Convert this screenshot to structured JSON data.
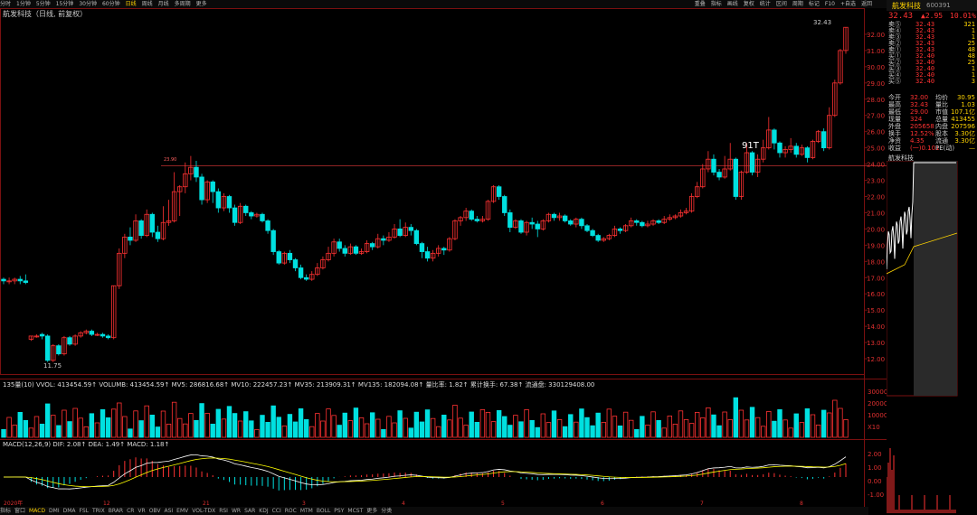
{
  "colors": {
    "up": "#ff3232",
    "down": "#00e0e0",
    "bg": "#000000",
    "grid": "#7a1010",
    "ma5": "#ffffff",
    "ma10": "#ffff00",
    "ma20": "#ff00ff",
    "vol_up": "#ff3232",
    "vol_down": "#00e0e0",
    "accent": "#ffd400"
  },
  "toolbar": {
    "left_tabs": [
      "分时",
      "1分钟",
      "5分钟",
      "15分钟",
      "30分钟",
      "60分钟",
      "日线",
      "周线",
      "月线",
      "多周期",
      "更多"
    ],
    "right_tabs": [
      "重叠",
      "指标",
      "画线",
      "复权",
      "统计",
      "区间",
      "周期",
      "标记",
      "F10",
      "+自选",
      "返回"
    ]
  },
  "chart_title": "航发科技（日线, 前复权）",
  "annotations": {
    "low_label": "11.75",
    "high_label": "32.43",
    "t_label": "91T",
    "hline_value": "23.90"
  },
  "vol_line": "135量(10) VVOL: 413454.59↑ VOLUMB: 413454.59↑ MV5: 286816.68↑ MV10: 222457.23↑ MV35: 213909.31↑ MV135: 182094.08↑ 量比率: 1.82↑ 累计换手: 67.38↑ 流通盘: 330129408.00",
  "macd_line": "MACD(12,26,9) DIF: 2.08↑ DEA: 1.49↑ MACD: 1.18↑",
  "y_axis": [
    "32.00",
    "31.00",
    "30.00",
    "29.00",
    "28.00",
    "27.00",
    "26.00",
    "25.00",
    "24.00",
    "23.00",
    "22.00",
    "21.00",
    "20.00",
    "19.00",
    "18.00",
    "17.00",
    "16.00",
    "15.00",
    "14.00",
    "13.00",
    "12.00"
  ],
  "vol_axis": [
    "30000",
    "20000",
    "10000",
    "X10"
  ],
  "macd_axis": [
    "2.00",
    "1.00",
    "0.00",
    "-1.00"
  ],
  "bottom_tabs": [
    "指标",
    "窗口",
    "MACD",
    "DMI",
    "DMA",
    "FSL",
    "TRIX",
    "BRAR",
    "CR",
    "VR",
    "OBV",
    "ASI",
    "EMV",
    "VOL-TDX",
    "RSI",
    "WR",
    "SAR",
    "KDJ",
    "CCI",
    "ROC",
    "MTM",
    "BOLL",
    "PSY",
    "MCST",
    "更多",
    "分类"
  ],
  "date_labels": [
    "2020年",
    "12",
    "21",
    "3",
    "4",
    "5",
    "6",
    "7",
    "8"
  ],
  "chart_data": {
    "type": "candlestick",
    "ylim": [
      11,
      33
    ],
    "candles": [
      [
        16.9,
        16.8,
        17,
        16.6
      ],
      [
        16.8,
        16.8,
        17,
        16.6
      ],
      [
        16.8,
        16.9,
        17,
        16.6
      ],
      [
        16.9,
        16.8,
        17.1,
        16.6
      ],
      [
        16.8,
        16.7,
        17.2,
        16.6
      ],
      [
        13.2,
        13.4,
        13.4,
        13.1
      ],
      [
        13.4,
        13.4,
        13.5,
        13.3
      ],
      [
        13.5,
        13.4,
        13.6,
        13.2
      ],
      [
        13.4,
        11.9,
        13.5,
        11.8
      ],
      [
        11.9,
        12.8,
        12.9,
        11.8
      ],
      [
        12.8,
        12.3,
        12.9,
        12.2
      ],
      [
        12.3,
        13.3,
        13.4,
        12.2
      ],
      [
        13.3,
        12.9,
        13.4,
        12.8
      ],
      [
        12.9,
        13.4,
        13.5,
        12.8
      ],
      [
        13.4,
        13.6,
        13.7,
        13.3
      ],
      [
        13.6,
        13.7,
        13.8,
        13.5
      ],
      [
        13.7,
        13.5,
        13.8,
        13.4
      ],
      [
        13.5,
        13.5,
        13.6,
        13.4
      ],
      [
        13.5,
        13.4,
        13.6,
        13.3
      ],
      [
        13.4,
        13.3,
        13.5,
        13.2
      ],
      [
        13.3,
        16.5,
        16.5,
        13.2
      ],
      [
        16.5,
        18.5,
        18.8,
        16.3
      ],
      [
        18.5,
        19.5,
        19.7,
        18.2
      ],
      [
        19.5,
        19.3,
        20.1,
        19.0
      ],
      [
        19.3,
        20.5,
        20.9,
        19.2
      ],
      [
        20.5,
        19.6,
        20.6,
        19.4
      ],
      [
        19.6,
        20.9,
        21.2,
        19.5
      ],
      [
        20.9,
        19.8,
        21.0,
        19.5
      ],
      [
        19.8,
        19.4,
        20.2,
        19.2
      ],
      [
        19.4,
        20.4,
        21.4,
        19.3
      ],
      [
        20.4,
        20.5,
        21.8,
        20.2
      ],
      [
        20.5,
        22.3,
        23.5,
        20.4
      ],
      [
        22.3,
        22.6,
        22.7,
        20.8
      ],
      [
        22.6,
        23.4,
        24.1,
        22.2
      ],
      [
        23.4,
        23.8,
        24.5,
        23.0
      ],
      [
        23.8,
        23.2,
        24.2,
        22.9
      ],
      [
        23.2,
        21.8,
        23.4,
        21.5
      ],
      [
        21.8,
        22.9,
        23.0,
        21.6
      ],
      [
        22.9,
        22.3,
        23.0,
        21.6
      ],
      [
        22.3,
        21.3,
        22.5,
        21.0
      ],
      [
        21.3,
        22.0,
        22.2,
        21.1
      ],
      [
        22.0,
        21.3,
        22.1,
        21.0
      ],
      [
        21.3,
        20.4,
        21.5,
        20.2
      ],
      [
        20.4,
        21.4,
        21.6,
        20.3
      ],
      [
        21.4,
        21.0,
        21.5,
        20.8
      ],
      [
        21.0,
        20.8,
        21.1,
        20.6
      ],
      [
        20.8,
        20.9,
        21.0,
        20.7
      ],
      [
        20.9,
        20.5,
        21.0,
        20.4
      ],
      [
        20.5,
        19.9,
        20.6,
        19.7
      ],
      [
        19.9,
        18.6,
        20.0,
        18.4
      ],
      [
        18.6,
        17.9,
        18.7,
        17.8
      ],
      [
        17.9,
        18.5,
        18.6,
        17.8
      ],
      [
        18.5,
        18.1,
        18.7,
        17.9
      ],
      [
        18.1,
        17.6,
        18.2,
        17.4
      ],
      [
        17.6,
        17.0,
        17.8,
        16.9
      ],
      [
        17.0,
        16.9,
        17.2,
        16.8
      ],
      [
        16.9,
        17.2,
        17.4,
        16.8
      ],
      [
        17.2,
        17.6,
        17.9,
        17.1
      ],
      [
        17.6,
        18.1,
        18.3,
        17.5
      ],
      [
        18.1,
        18.5,
        18.9,
        18.0
      ],
      [
        18.5,
        19.2,
        19.4,
        18.3
      ],
      [
        19.2,
        18.8,
        19.4,
        18.6
      ],
      [
        18.8,
        18.5,
        19.0,
        18.3
      ],
      [
        18.5,
        18.9,
        19.1,
        18.4
      ],
      [
        18.9,
        18.5,
        19.0,
        18.4
      ],
      [
        18.5,
        18.6,
        18.8,
        18.4
      ],
      [
        18.6,
        19.1,
        19.3,
        18.5
      ],
      [
        19.1,
        18.9,
        19.2,
        18.7
      ],
      [
        18.9,
        19.4,
        19.7,
        18.8
      ],
      [
        19.4,
        19.3,
        19.6,
        19.0
      ],
      [
        19.3,
        19.5,
        19.8,
        19.2
      ],
      [
        19.5,
        20.0,
        20.3,
        19.4
      ],
      [
        20.0,
        19.6,
        20.6,
        19.5
      ],
      [
        19.6,
        20.1,
        20.4,
        19.5
      ],
      [
        20.1,
        19.9,
        20.3,
        19.6
      ],
      [
        19.9,
        19.1,
        20.0,
        19.0
      ],
      [
        19.1,
        18.6,
        19.2,
        18.2
      ],
      [
        18.6,
        18.2,
        18.9,
        18.0
      ],
      [
        18.2,
        18.5,
        18.7,
        18.0
      ],
      [
        18.5,
        18.8,
        19.0,
        18.3
      ],
      [
        18.8,
        18.7,
        18.9,
        18.4
      ],
      [
        18.7,
        19.4,
        19.5,
        18.6
      ],
      [
        19.4,
        20.5,
        20.6,
        19.3
      ],
      [
        20.5,
        20.7,
        20.8,
        20.2
      ],
      [
        20.7,
        21.1,
        21.3,
        20.5
      ],
      [
        21.1,
        20.6,
        21.2,
        20.5
      ],
      [
        20.6,
        20.5,
        20.8,
        20.4
      ],
      [
        20.5,
        20.6,
        20.8,
        20.4
      ],
      [
        20.6,
        21.7,
        21.8,
        20.5
      ],
      [
        21.7,
        22.6,
        22.7,
        21.6
      ],
      [
        22.6,
        22.0,
        22.7,
        21.8
      ],
      [
        22.0,
        21.0,
        22.1,
        20.8
      ],
      [
        21.0,
        20.1,
        21.2,
        19.8
      ],
      [
        20.1,
        20.5,
        20.6,
        20.0
      ],
      [
        20.5,
        19.8,
        20.6,
        19.7
      ],
      [
        19.8,
        20.4,
        20.5,
        19.6
      ],
      [
        20.4,
        20.3,
        20.7,
        20.0
      ],
      [
        20.3,
        20.0,
        20.5,
        19.5
      ],
      [
        20.0,
        20.5,
        20.6,
        19.9
      ],
      [
        20.5,
        20.9,
        21.0,
        20.4
      ],
      [
        20.9,
        20.7,
        21.0,
        20.5
      ],
      [
        20.7,
        20.8,
        21.0,
        20.5
      ],
      [
        20.8,
        20.5,
        20.9,
        20.4
      ],
      [
        20.5,
        20.3,
        20.6,
        20.2
      ],
      [
        20.3,
        20.6,
        20.7,
        20.1
      ],
      [
        20.6,
        20.2,
        20.7,
        20.0
      ],
      [
        20.2,
        19.9,
        20.3,
        19.8
      ],
      [
        19.9,
        19.6,
        20.0,
        19.5
      ],
      [
        19.6,
        19.3,
        19.7,
        19.2
      ],
      [
        19.3,
        19.4,
        19.5,
        19.2
      ],
      [
        19.4,
        19.6,
        19.7,
        19.3
      ],
      [
        19.6,
        20.0,
        20.2,
        19.5
      ],
      [
        20.0,
        19.9,
        20.1,
        19.7
      ],
      [
        19.9,
        20.2,
        20.3,
        19.8
      ],
      [
        20.2,
        20.5,
        20.7,
        20.1
      ],
      [
        20.5,
        20.4,
        20.6,
        20.2
      ],
      [
        20.4,
        20.2,
        20.5,
        20.1
      ],
      [
        20.2,
        20.3,
        20.5,
        20.1
      ],
      [
        20.3,
        20.5,
        20.6,
        20.2
      ],
      [
        20.5,
        20.4,
        20.6,
        20.3
      ],
      [
        20.4,
        20.6,
        20.8,
        20.3
      ],
      [
        20.6,
        20.7,
        20.9,
        20.5
      ],
      [
        20.7,
        20.8,
        20.9,
        20.6
      ],
      [
        20.8,
        21.0,
        21.2,
        20.7
      ],
      [
        21.0,
        21.1,
        21.3,
        20.9
      ],
      [
        21.1,
        22.0,
        22.2,
        21.0
      ],
      [
        22.0,
        22.6,
        22.9,
        21.9
      ],
      [
        22.6,
        23.7,
        24.0,
        22.5
      ],
      [
        23.7,
        24.3,
        24.8,
        23.5
      ],
      [
        24.3,
        23.5,
        24.6,
        23.3
      ],
      [
        23.5,
        23.2,
        23.7,
        23.0
      ],
      [
        23.2,
        23.7,
        24.5,
        23.1
      ],
      [
        23.7,
        24.3,
        25.3,
        23.6
      ],
      [
        24.3,
        22.0,
        24.4,
        21.8
      ],
      [
        22.0,
        23.5,
        23.6,
        21.8
      ],
      [
        23.5,
        24.7,
        25.3,
        23.4
      ],
      [
        24.7,
        23.5,
        24.8,
        23.3
      ],
      [
        23.5,
        24.3,
        24.6,
        23.2
      ],
      [
        24.3,
        25.0,
        25.5,
        24.1
      ],
      [
        25.0,
        26.1,
        26.9,
        24.9
      ],
      [
        26.1,
        25.3,
        26.2,
        24.9
      ],
      [
        25.3,
        24.7,
        25.4,
        24.4
      ],
      [
        24.7,
        24.9,
        25.1,
        24.4
      ],
      [
        24.9,
        25.1,
        25.6,
        24.7
      ],
      [
        25.1,
        24.6,
        25.3,
        24.4
      ],
      [
        24.6,
        25.0,
        25.2,
        24.5
      ],
      [
        25.0,
        24.4,
        25.1,
        24.1
      ],
      [
        24.4,
        25.4,
        25.5,
        24.3
      ],
      [
        25.4,
        26.0,
        26.1,
        25.3
      ],
      [
        26.0,
        25.0,
        26.2,
        24.8
      ],
      [
        25.0,
        27.0,
        27.5,
        24.9
      ],
      [
        27.0,
        29.0,
        29.2,
        26.9
      ],
      [
        29.0,
        31.0,
        31.1,
        28.9
      ],
      [
        31.0,
        32.43,
        32.43,
        30.8
      ]
    ],
    "vol_ma": [
      [
        "MV5",
        "#ffffff"
      ],
      [
        "MV10",
        "#ffff00"
      ],
      [
        "MV35",
        "#ff00ff"
      ],
      [
        "MV135",
        "#00ff00"
      ]
    ]
  }
}
